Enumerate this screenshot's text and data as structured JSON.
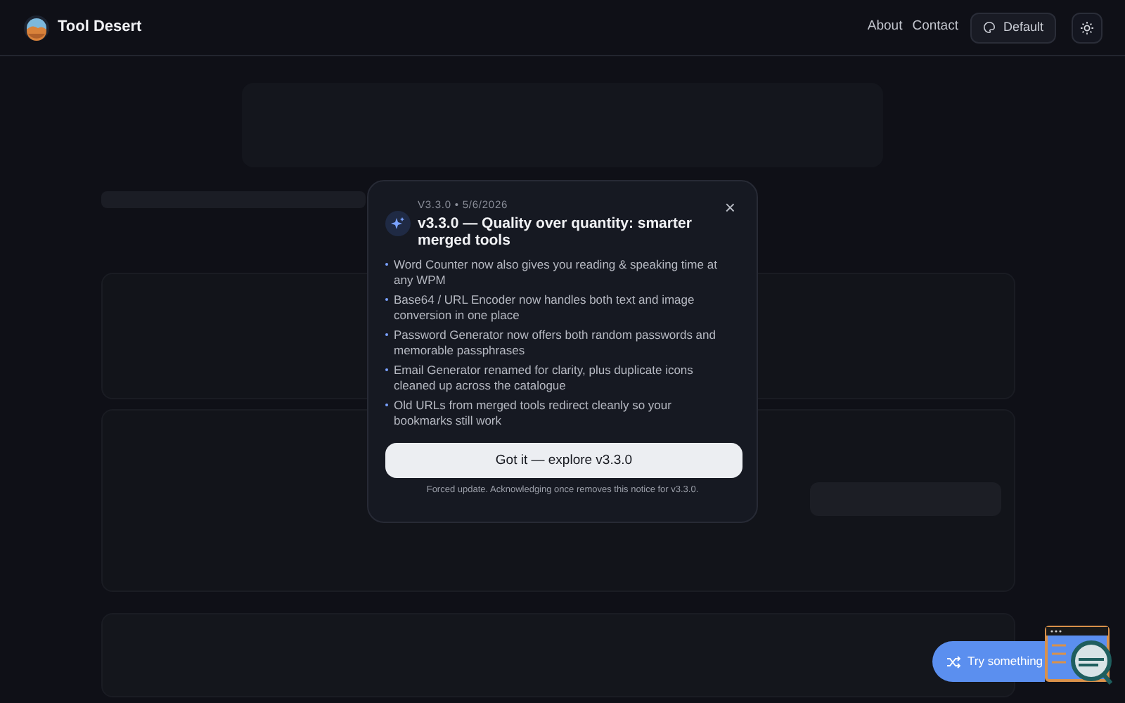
{
  "header": {
    "brand": "Tool Desert",
    "nav": [
      "About",
      "Contact"
    ],
    "theme_button": "Default"
  },
  "modal": {
    "eyebrow": "V3.3.0 • 5/6/2026",
    "title": "v3.3.0 — Quality over quantity: smarter merged tools",
    "close": "×",
    "items": [
      "Word Counter now also gives you reading & speaking time at any WPM",
      "Base64 / URL Encoder now handles both text and image conversion in one place",
      "Password Generator now offers both random passwords and memorable passphrases",
      "Email Generator renamed for clarity, plus duplicate icons cleaned up across the catalogue",
      "Old URLs from merged tools redirect cleanly so your bookmarks still work"
    ],
    "button": "Got it — explore v3.3.0",
    "note": "Forced update. Acknowledging once removes this notice for v3.3.0."
  },
  "floating_button": "Try something"
}
